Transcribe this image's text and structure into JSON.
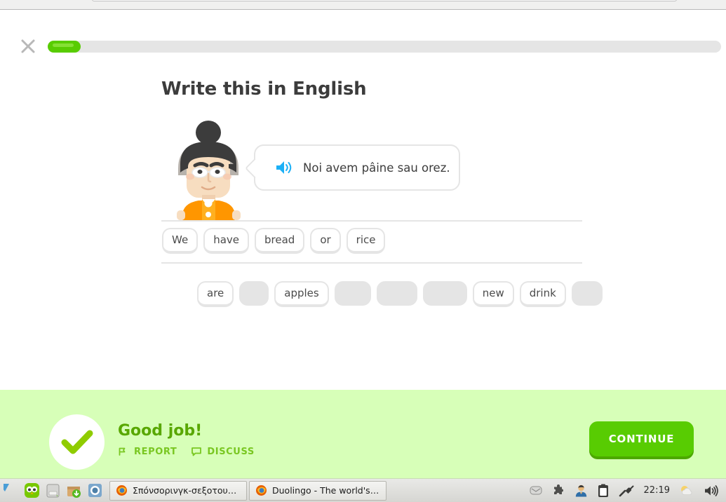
{
  "window": {
    "browser": "firefox"
  },
  "header": {
    "close_icon": "close-icon",
    "progress_percent": 4,
    "progress_fill_color": "#58cc02",
    "progress_track_color": "#e5e5e5"
  },
  "exercise": {
    "title": "Write this in English",
    "speaker_icon": "speaker-icon",
    "speaker_color": "#1cb0f6",
    "prompt_sentence": "Noi avem pâine sau orez.",
    "answer_tiles": [
      "We",
      "have",
      "bread",
      "or",
      "rice"
    ],
    "word_bank": [
      {
        "label": "are",
        "used": false
      },
      {
        "label": "",
        "used": true
      },
      {
        "label": "apples",
        "used": false
      },
      {
        "label": "",
        "used": true
      },
      {
        "label": "",
        "used": true
      },
      {
        "label": "",
        "used": true
      },
      {
        "label": "new",
        "used": false
      },
      {
        "label": "drink",
        "used": false
      },
      {
        "label": "",
        "used": true
      }
    ]
  },
  "feedback": {
    "background_color": "#d7ffb8",
    "check_icon": "check-icon",
    "check_color": "#8fcc00",
    "title": "Good job!",
    "title_color": "#58a700",
    "report_label": "REPORT",
    "report_icon": "flag-icon",
    "discuss_label": "DISCUSS",
    "discuss_icon": "speech-bubble-icon",
    "continue_label": "CONTINUE",
    "continue_color": "#58cc02"
  },
  "taskbar": {
    "launchers": [
      {
        "name": "partial-app-icon",
        "title": ""
      },
      {
        "name": "duolingo-icon",
        "title": "Duolingo"
      },
      {
        "name": "drive-icon",
        "title": "Files"
      },
      {
        "name": "software-updater-icon",
        "title": "Software Updater"
      },
      {
        "name": "chromium-icon",
        "title": "Chromium"
      }
    ],
    "windows": [
      {
        "icon": "firefox-icon",
        "label": "Σπόνσορινγκ-σεξοτουρ…"
      },
      {
        "icon": "firefox-icon",
        "label": "Duolingo - The world's …"
      }
    ],
    "tray": [
      {
        "name": "mail-icon"
      },
      {
        "name": "puzzle-icon"
      },
      {
        "name": "user-avatar-icon"
      },
      {
        "name": "clipboard-icon"
      },
      {
        "name": "plug-icon"
      }
    ],
    "clock": "22:19",
    "tray_right": [
      {
        "name": "weather-icon"
      },
      {
        "name": "volume-icon"
      }
    ]
  }
}
